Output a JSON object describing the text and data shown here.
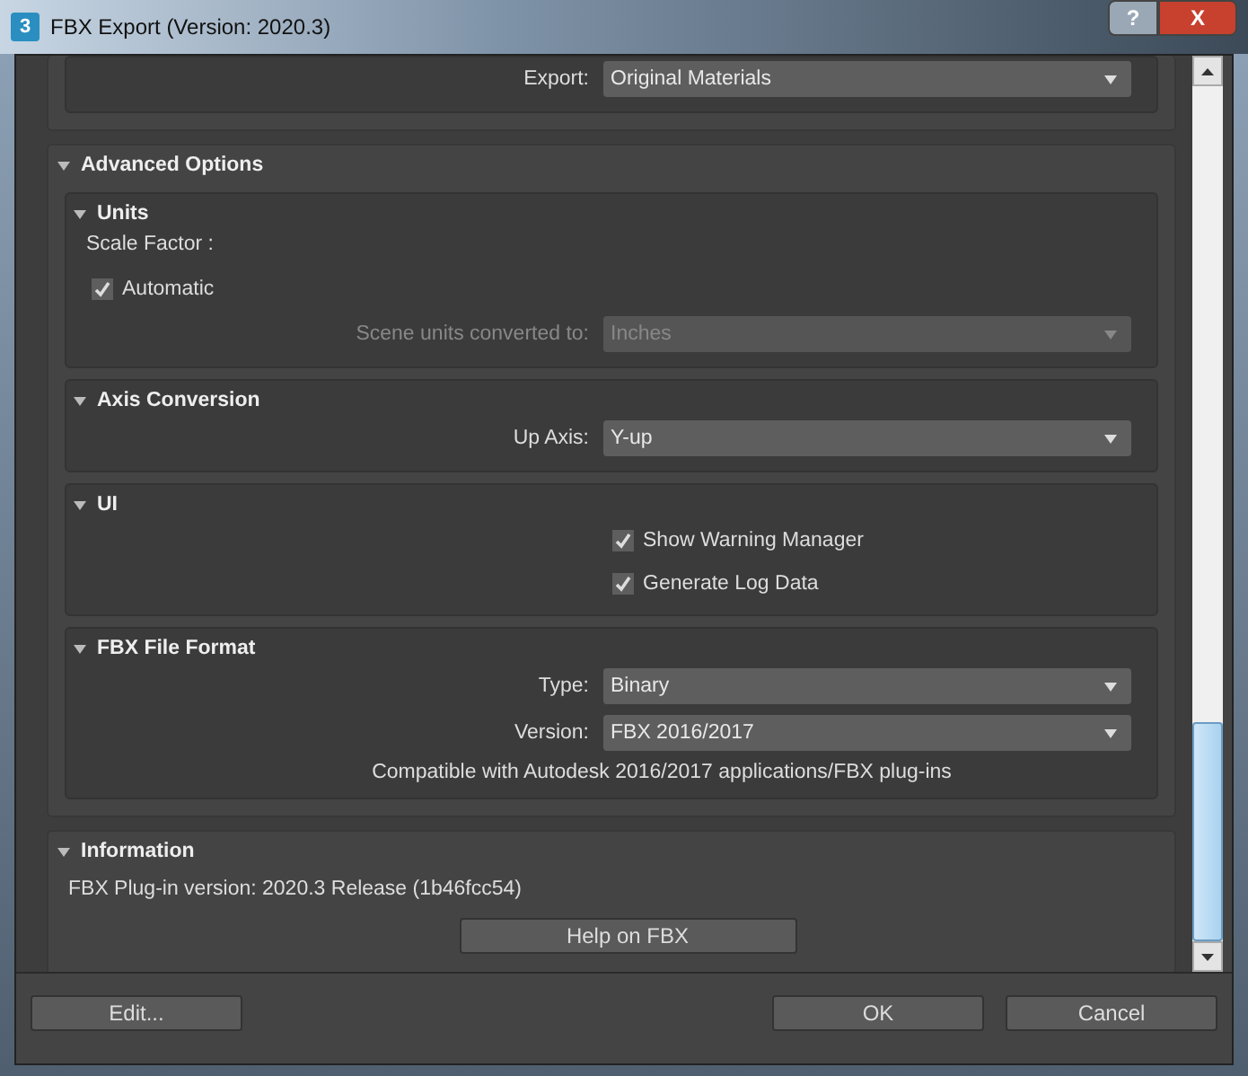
{
  "window": {
    "app_icon": "3",
    "title": "FBX Export (Version: 2020.3)",
    "help_button": "?",
    "close_button": "X"
  },
  "top_panel": {
    "rows": [
      {
        "kind": "dropdown",
        "label": "Export:",
        "value": "Original Materials",
        "disabled": false
      }
    ]
  },
  "advanced": {
    "title": "Advanced Options",
    "expanded": true,
    "sections": [
      {
        "title": "Units",
        "expanded": true,
        "rows": [
          {
            "kind": "label",
            "label": "Scale Factor :"
          },
          {
            "kind": "checkbox",
            "label": "Automatic",
            "checked": true,
            "indent": false
          },
          {
            "kind": "dropdown",
            "label": "Scene units converted to:",
            "value": "Inches",
            "disabled": true
          }
        ]
      },
      {
        "title": "Axis Conversion",
        "expanded": true,
        "rows": [
          {
            "kind": "dropdown",
            "label": "Up Axis:",
            "value": "Y-up",
            "disabled": false
          }
        ]
      },
      {
        "title": "UI",
        "expanded": true,
        "rows": [
          {
            "kind": "checkbox",
            "label": "Show Warning Manager",
            "checked": true,
            "indent": true
          },
          {
            "kind": "checkbox",
            "label": "Generate Log Data",
            "checked": true,
            "indent": true
          }
        ]
      },
      {
        "title": "FBX File Format",
        "expanded": true,
        "rows": [
          {
            "kind": "dropdown",
            "label": "Type:",
            "value": "Binary",
            "disabled": false
          },
          {
            "kind": "dropdown",
            "label": "Version:",
            "value": "FBX 2016/2017",
            "disabled": false
          },
          {
            "kind": "note",
            "label": "Compatible with Autodesk 2016/2017 applications/FBX plug-ins"
          }
        ]
      }
    ]
  },
  "information": {
    "title": "Information",
    "expanded": true,
    "version": "FBX Plug-in version: 2020.3 Release (1b46fcc54)",
    "button": "Help on FBX"
  },
  "buttons": {
    "edit": "Edit...",
    "ok": "OK",
    "cancel": "Cancel"
  }
}
